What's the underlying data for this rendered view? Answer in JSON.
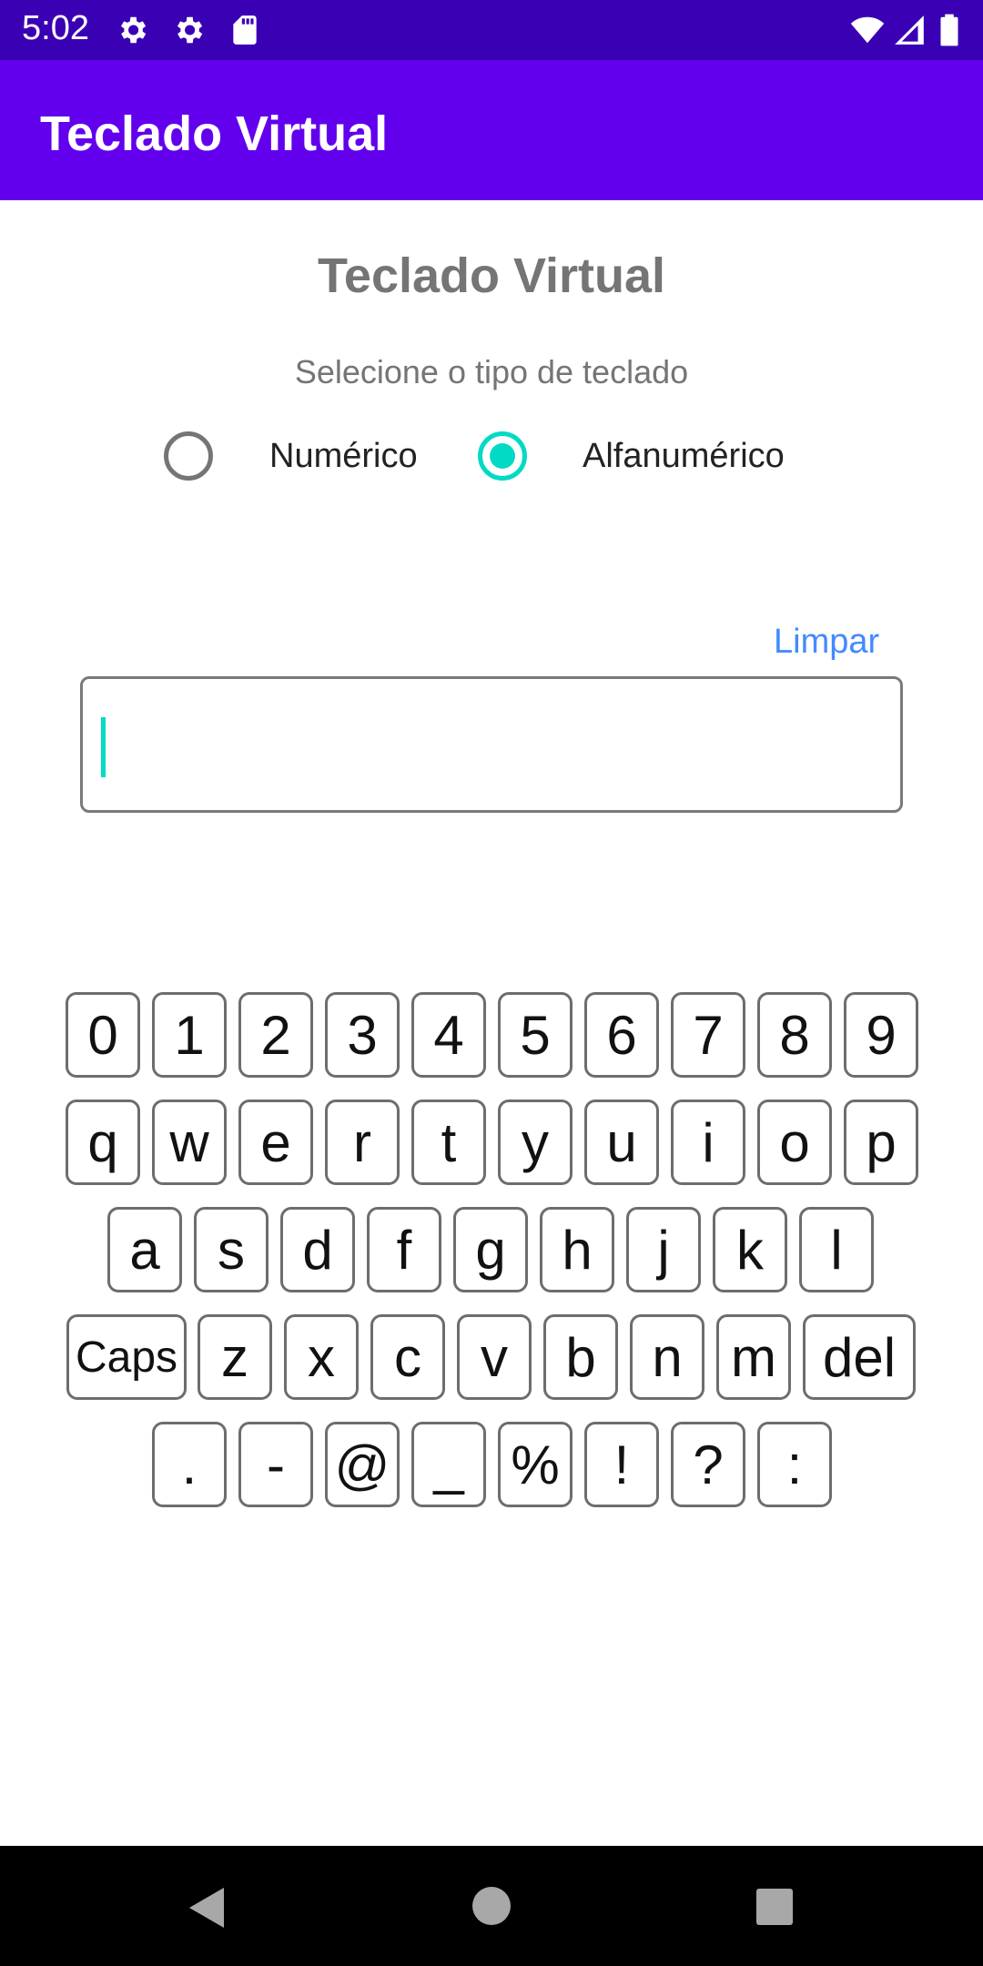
{
  "status_bar": {
    "time": "5:02"
  },
  "app_bar": {
    "title": "Teclado Virtual"
  },
  "content": {
    "title": "Teclado Virtual",
    "subtitle": "Selecione o tipo de teclado",
    "radio_options": [
      {
        "label": "Numérico",
        "selected": false
      },
      {
        "label": "Alfanumérico",
        "selected": true
      }
    ],
    "clear_label": "Limpar",
    "input_value": ""
  },
  "keyboard": {
    "row1": [
      "0",
      "1",
      "2",
      "3",
      "4",
      "5",
      "6",
      "7",
      "8",
      "9"
    ],
    "row2": [
      "q",
      "w",
      "e",
      "r",
      "t",
      "y",
      "u",
      "i",
      "o",
      "p"
    ],
    "row3": [
      "a",
      "s",
      "d",
      "f",
      "g",
      "h",
      "j",
      "k",
      "l"
    ],
    "row4": [
      "Caps",
      "z",
      "x",
      "c",
      "v",
      "b",
      "n",
      "m",
      "del"
    ],
    "row5": [
      ".",
      "-",
      "@",
      "_",
      "%",
      "!",
      "?",
      ":"
    ]
  },
  "colors": {
    "status_bar": "#3a00b4",
    "app_bar": "#6200ee",
    "accent": "#03dac5",
    "link": "#448aff"
  }
}
